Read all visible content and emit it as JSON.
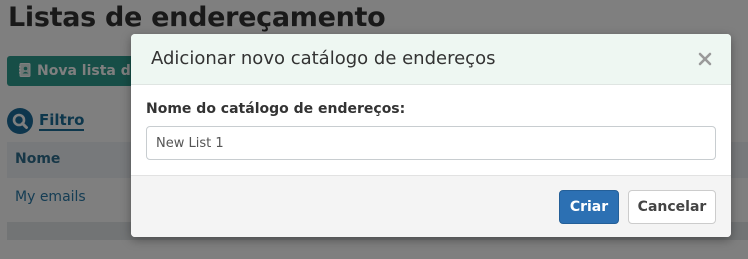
{
  "page": {
    "title": "Listas de endereçamento",
    "new_list_button": "Nova lista de",
    "filter_label": "Filtro",
    "table": {
      "columns": [
        "Nome"
      ],
      "rows": [
        {
          "name": "My emails"
        }
      ]
    }
  },
  "modal": {
    "title": "Adicionar novo catálogo de endereços",
    "field_label": "Nome do catálogo de endereços:",
    "field_value": "New List 1",
    "create_label": "Criar",
    "cancel_label": "Cancelar"
  },
  "icons": {
    "close": "close-icon",
    "filter": "search-icon",
    "new_list": "address-book-icon"
  },
  "colors": {
    "accent_teal": "#2f9c8e",
    "primary_blue": "#2c70b3",
    "link_blue": "#2a7aa8"
  }
}
